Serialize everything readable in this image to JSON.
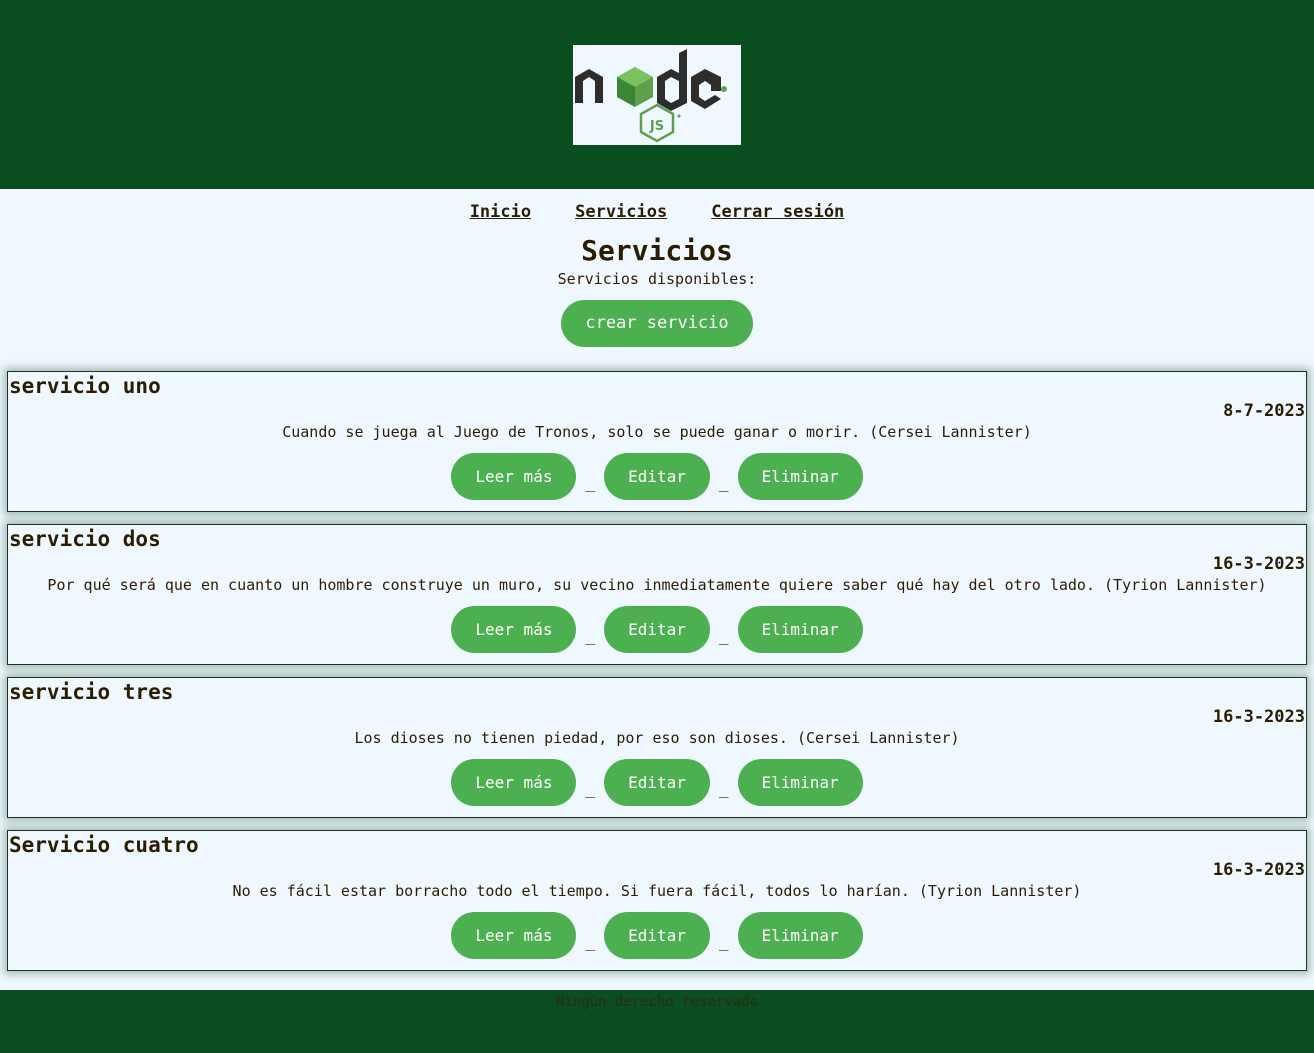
{
  "nav": {
    "items": [
      "Inicio",
      "Servicios",
      "Cerrar sesión"
    ]
  },
  "page": {
    "title": "Servicios",
    "subtitle": "Servicios disponibles:",
    "create_label": "crear servicio"
  },
  "buttons": {
    "read": "Leer más",
    "edit": "Editar",
    "delete": "Eliminar",
    "separator": "_"
  },
  "services": [
    {
      "title": "servicio uno",
      "date": "8-7-2023",
      "description": "Cuando se juega al Juego de Tronos, solo se puede ganar o morir. (Cersei Lannister)"
    },
    {
      "title": "servicio dos",
      "date": "16-3-2023",
      "description": "Por qué será que en cuanto un hombre construye un muro, su vecino inmediatamente quiere saber qué hay del otro lado. (Tyrion Lannister)"
    },
    {
      "title": "servicio tres",
      "date": "16-3-2023",
      "description": "Los dioses no tienen piedad, por eso son dioses. (Cersei Lannister)"
    },
    {
      "title": "Servicio cuatro",
      "date": "16-3-2023",
      "description": "No es fácil estar borracho todo el tiempo. Si fuera fácil, todos lo harían. (Tyrion Lannister)"
    }
  ],
  "footer": {
    "text": "Ningún derecho reservado"
  },
  "colors": {
    "header_bg": "#0a4d1f",
    "button": "#4caf50",
    "page_bg": "#f0f8ff"
  },
  "logo": {
    "icon": "nodejs-logo"
  }
}
